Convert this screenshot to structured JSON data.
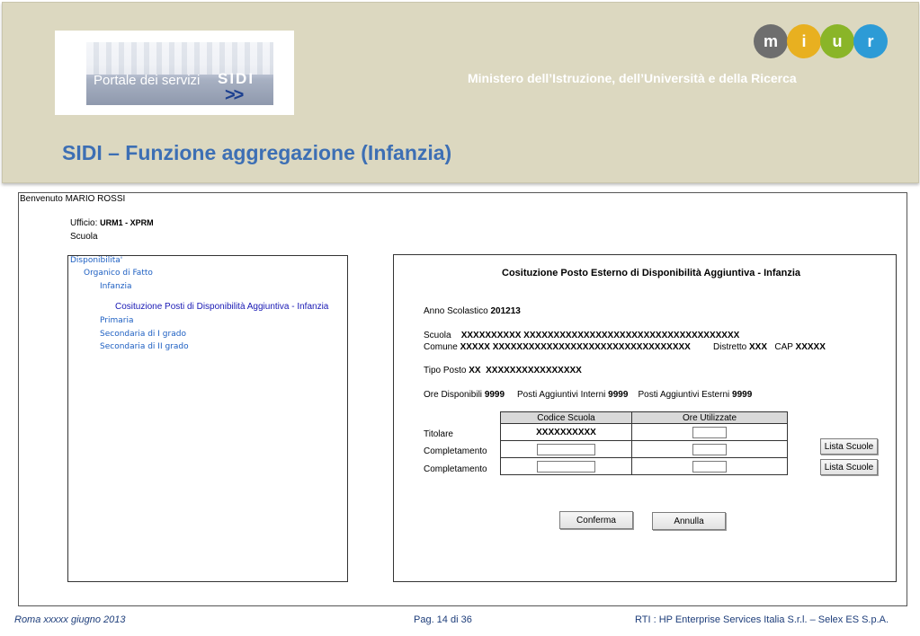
{
  "banner": {
    "portal_text": "Portale dei servizi",
    "portal_brand": "SIDI",
    "portal_arrows": ">>",
    "ministry": "Ministero dell’Istruzione, dell’Università e della Ricerca",
    "miur_letters": [
      "m",
      "i",
      "u",
      "r"
    ],
    "miur_colors": [
      "#6e6e6e",
      "#e8b020",
      "#8ab528",
      "#2d9bd6"
    ]
  },
  "slide_title": "SIDI – Funzione aggregazione (Infanzia)",
  "app": {
    "welcome": "Benvenuto MARIO ROSSI",
    "ufficio_label": "Ufficio:",
    "ufficio_value": "URM1 - XPRM",
    "scuola_label": "Scuola"
  },
  "tree": {
    "disponibilita": "Disponibilita'",
    "organico": "Organico di Fatto",
    "infanzia": "Infanzia",
    "costituzione": "Cosituzione Posti di Disponibilità Aggiuntiva - Infanzia",
    "primaria": "Primaria",
    "sec1": "Secondaria di I grado",
    "sec2": "Secondaria di II grado"
  },
  "form": {
    "title": "Cosituzione Posto Esterno di Disponibilità Aggiuntiva  - Infanzia",
    "anno_label": "Anno Scolastico",
    "anno_value": "201213",
    "scuola_label": "Scuola",
    "scuola_value": "XXXXXXXXXX XXXXXXXXXXXXXXXXXXXXXXXXXXXXXXXXXXXX",
    "comune_label": "Comune",
    "comune_value": "XXXXX XXXXXXXXXXXXXXXXXXXXXXXXXXXXXXXXX",
    "distretto_label": "Distretto",
    "distretto_value": "XXX",
    "cap_label": "CAP",
    "cap_value": "XXXXX",
    "tipo_label": "Tipo Posto",
    "tipo_code": "XX",
    "tipo_value": "XXXXXXXXXXXXXXXX",
    "ore_disp_label": "Ore Disponibili",
    "ore_disp_value": "9999",
    "posti_int_label": "Posti Aggiuntivi Interni",
    "posti_int_value": "9999",
    "posti_est_label": "Posti Aggiuntivi Esterni",
    "posti_est_value": "9999",
    "table": {
      "col1": "Codice Scuola",
      "col2": "Ore Utilizzate",
      "row1_label": "Titolare",
      "row1_code": "XXXXXXXXXX",
      "row2_label": "Completamento",
      "row3_label": "Completamento"
    },
    "lista_scuole": "Lista Scuole",
    "conferma": "Conferma",
    "annulla": "Annulla"
  },
  "footer": {
    "left": "Roma xxxxx giugno 2013",
    "center": "Pag. 14 di 36",
    "right": "RTI : HP Enterprise Services Italia S.r.l. – Selex ES S.p.A."
  }
}
